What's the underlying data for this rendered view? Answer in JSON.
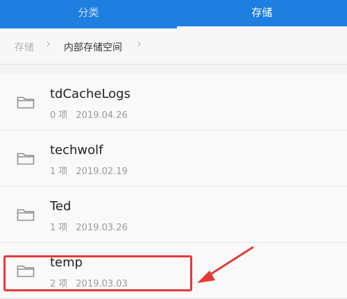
{
  "tabs": {
    "classify": "分类",
    "storage": "存储"
  },
  "breadcrumb": {
    "root": "存储",
    "current": "内部存储空间"
  },
  "files": [
    {
      "name": "tdCacheLogs",
      "count": "0 项",
      "date": "2019.04.26"
    },
    {
      "name": "techwolf",
      "count": "1 项",
      "date": "2019.02.19"
    },
    {
      "name": "Ted",
      "count": "1 项",
      "date": "2019.03.26"
    },
    {
      "name": "temp",
      "count": "2 项",
      "date": "2019.03.03"
    }
  ],
  "icons": {
    "folder": "folder-icon",
    "chevron": "chevron-right-icon"
  },
  "colors": {
    "accent": "#1f7fe0",
    "highlight": "#e53935"
  }
}
